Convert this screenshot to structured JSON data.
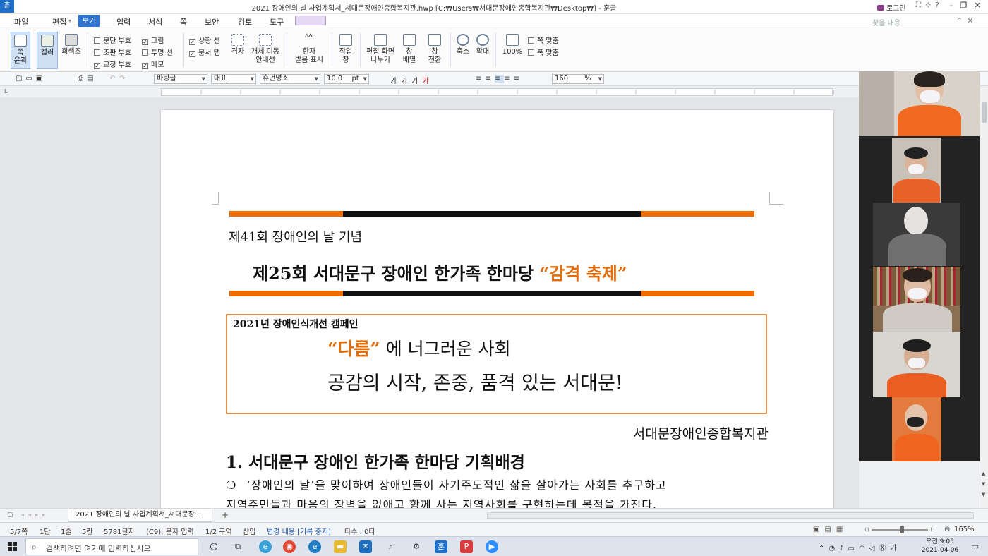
{
  "window": {
    "app_icon": "훈",
    "title": "2021 장애인의 날 사업계획서_서대문장애인종합복지관.hwp [C:₩Users₩서대문장애인종합복지관₩Desktop₩] - 훈글",
    "login": "로그인"
  },
  "menu": {
    "file": "파일",
    "edit": "편집",
    "view": "보기",
    "insert": "입력",
    "format": "서식",
    "page": "쪽",
    "security": "보안",
    "review": "검토",
    "tools": "도구",
    "search_hint": "찾을 내용"
  },
  "ribbon": {
    "page_outline": "쪽\n윤곽",
    "color": "컬러",
    "grayscale": "회색조",
    "checks": [
      {
        "label": "문단 부호",
        "checked": false
      },
      {
        "label": "조판 부호",
        "checked": false
      },
      {
        "label": "교정 부호",
        "checked": true
      },
      {
        "label": "그림",
        "checked": true
      },
      {
        "label": "투명 선",
        "checked": false
      },
      {
        "label": "메모",
        "checked": true
      },
      {
        "label": "상황 선",
        "checked": true
      },
      {
        "label": "문서 탭",
        "checked": true
      }
    ],
    "grid": "격자",
    "obj_move": "개체 이동\n안내선",
    "hanja": "한자\n발음 표시",
    "work_window": "작업\n창",
    "split": "편집 화면\n나누기",
    "arrange": "창\n배열",
    "switch": "창\n전환",
    "zoom_out": "축소",
    "zoom_in": "확대",
    "zoom_100": "100%",
    "fit_page": "쪽 맞춤",
    "fit_width": "폭 맞춤"
  },
  "format_bar": {
    "font_lang": "바탕글",
    "style": "대표",
    "font": "휴먼명조",
    "size": "10.0",
    "unit": "pt",
    "zoom": "160",
    "zoom_unit": "%"
  },
  "document": {
    "subtitle": "제41회 장애인의 날 기념",
    "title_main": "제25회 서대문구 장애인 한가족 한마당 ",
    "title_accent": "“감격 축제”",
    "campaign_label": "2021년 장애인식개선 캠페인",
    "slogan_accent": "“다름”",
    "slogan_rest": " 에 너그러운 사회",
    "slogan_line2": "공감의 시작, 존중, 품격 있는 서대문!",
    "org": "서대문장애인종합복지관",
    "section": "1. 서대문구 장애인 한가족 한마당 기획배경",
    "body_bullet": "❍",
    "body1": "‘장애인의 날’을 맞이하여 장애인들이 자기주도적인 삶을 살아가는 사회를 추구하고",
    "body2": "지역주민들과 마음의 장벽을 없애고 함께 사는 지역사회를 구현하는데 목적을 가진다."
  },
  "tab": {
    "label": "2021 장애인의 날 사업계획서_서대문장···",
    "add": "+"
  },
  "status": {
    "page": "5/7쪽",
    "column": "1단",
    "line": "1줄",
    "col": "5칸",
    "chars": "5781글자",
    "mode": "(C9): 문자 입력",
    "section": "1/2 구역",
    "insert": "삽입",
    "track": "변경 내용 [기록 중지]",
    "typos": "타수 : 0타",
    "zoom": "165%"
  },
  "taskbar": {
    "search_placeholder": "검색하려면 여기에 입력하십시오.",
    "time": "오전 9:05",
    "date": "2021-04-06"
  },
  "colors": {
    "accent": "#2b74d8",
    "orange": "#e36c09",
    "bar_orange": "#ef6c00",
    "bar_black": "#111111"
  }
}
